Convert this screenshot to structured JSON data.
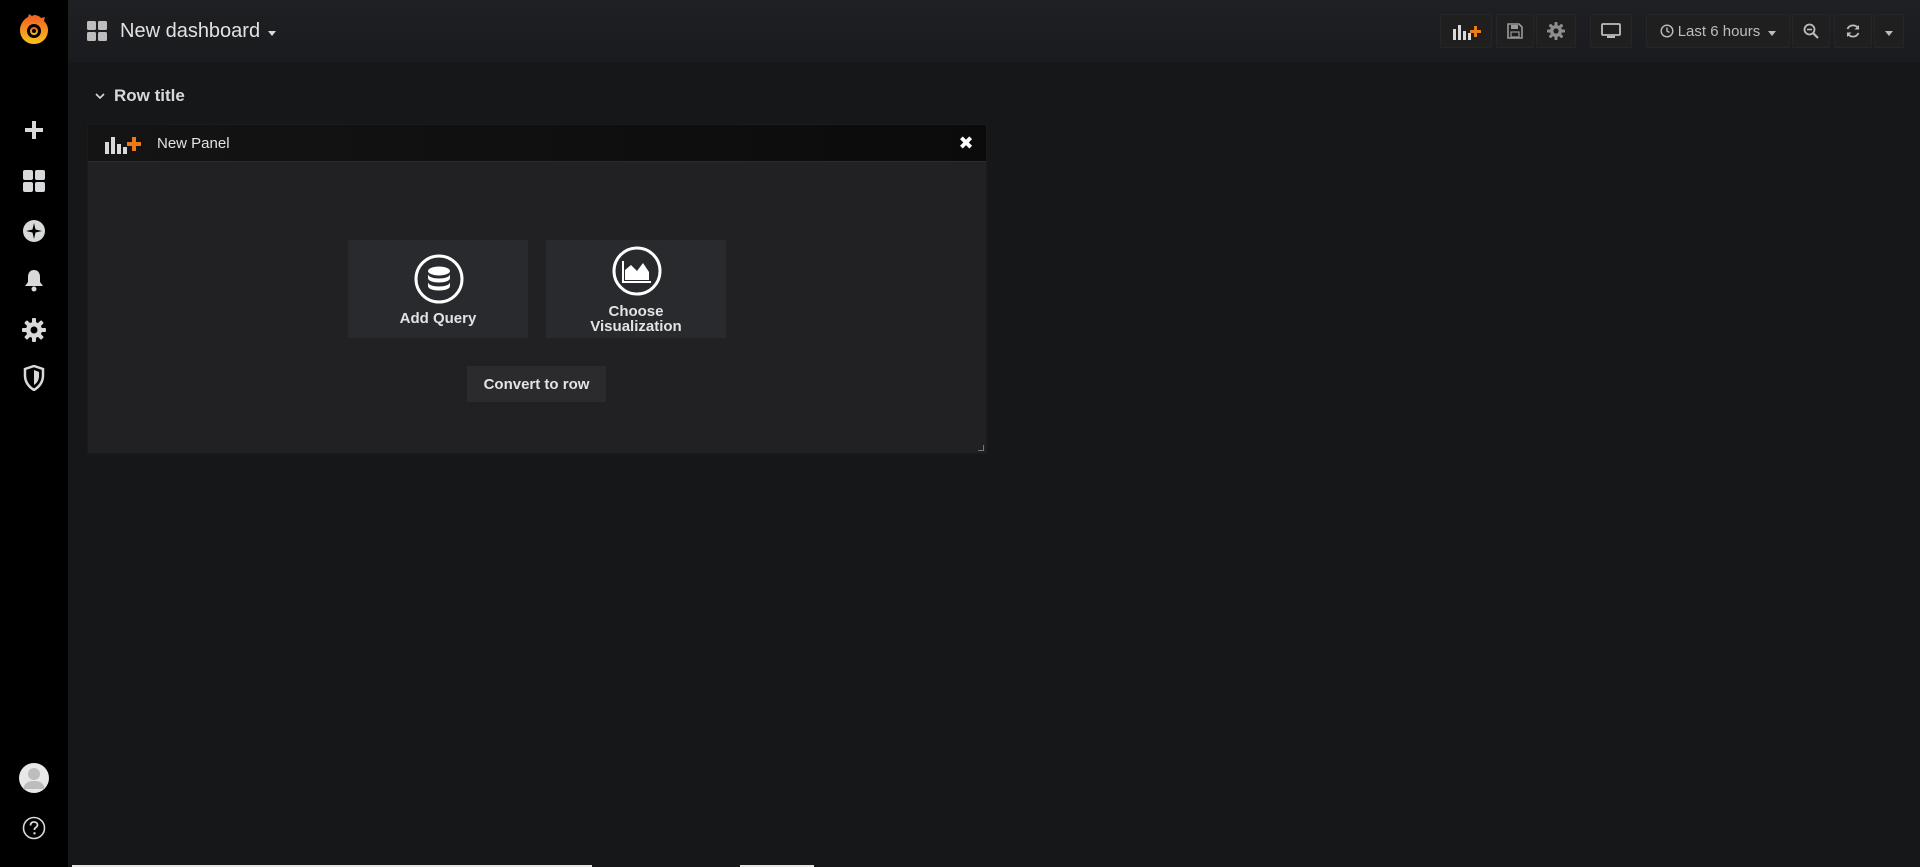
{
  "sidebar": {
    "items": [
      {
        "name": "grafana-logo-icon"
      },
      {
        "name": "plus-icon",
        "label": "Create"
      },
      {
        "name": "dashboards-icon",
        "label": "Dashboards"
      },
      {
        "name": "explore-icon",
        "label": "Explore"
      },
      {
        "name": "bell-icon",
        "label": "Alerting"
      },
      {
        "name": "gear-icon",
        "label": "Configuration"
      },
      {
        "name": "shield-icon",
        "label": "Server Admin"
      },
      {
        "name": "avatar-icon",
        "label": "Profile"
      },
      {
        "name": "help-icon",
        "label": "Help"
      }
    ]
  },
  "header": {
    "title": "New dashboard",
    "time_range": "Last 6 hours",
    "buttons": [
      "add-panel-icon",
      "save-icon",
      "gear-icon",
      "tv-icon",
      "clock-icon",
      "zoom-out-icon",
      "refresh-icon",
      "chevron-down-icon"
    ]
  },
  "row": {
    "title": "Row title"
  },
  "panel": {
    "title": "New Panel",
    "actions": {
      "add_query": "Add Query",
      "choose_visualization_line1": "Choose",
      "choose_visualization_line2": "Visualization"
    },
    "convert_to_row": "Convert to row"
  },
  "colors": {
    "background": "#161719",
    "sidebar": "#000000",
    "panel": "#212124",
    "accent_orange": "#eb7b18"
  }
}
